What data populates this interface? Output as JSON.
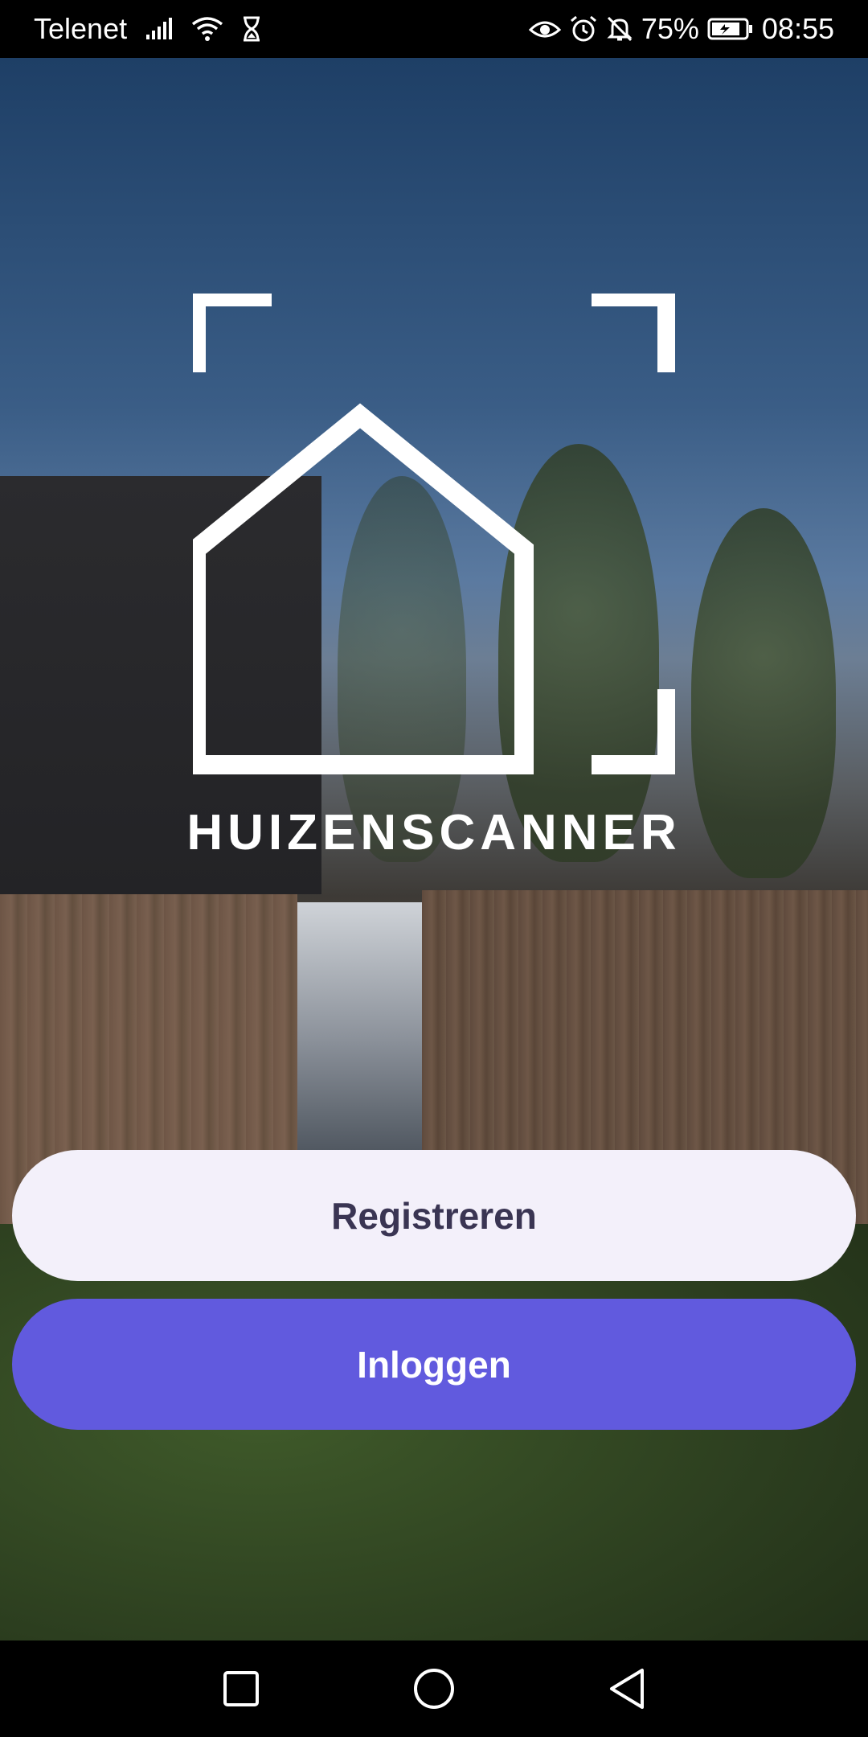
{
  "status_bar": {
    "carrier": "Telenet",
    "battery_percent": "75%",
    "time": "08:55",
    "left_icons": [
      "signal-icon",
      "wifi-icon",
      "hourglass-icon"
    ],
    "right_icons": [
      "eye-icon",
      "alarm-icon",
      "bell-off-icon",
      "battery-icon"
    ]
  },
  "brand": {
    "name": "HUIZENSCANNER",
    "logo_icon": "house-scan-icon",
    "logo_color": "#ffffff"
  },
  "actions": {
    "register_label": "Registreren",
    "login_label": "Inloggen",
    "register_bg": "#f3f0fa",
    "login_bg": "#615ade"
  },
  "nav_bar": {
    "buttons": [
      "recent-apps-icon",
      "home-icon",
      "back-icon"
    ]
  }
}
